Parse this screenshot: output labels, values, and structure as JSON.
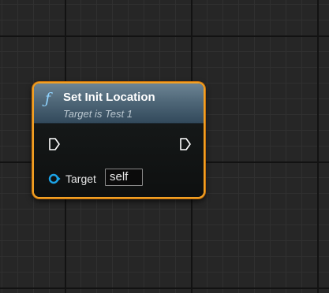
{
  "node": {
    "icon": "function-icon",
    "icon_glyph": "ƒ",
    "title": "Set Init Location",
    "subtitle": "Target is Test 1",
    "pins": {
      "exec_in": "exec-input-pin",
      "exec_out": "exec-output-pin",
      "target": {
        "label": "Target",
        "value": "self"
      }
    },
    "colors": {
      "selection_border": "#f2a024",
      "header_top": "#6d8494",
      "header_bottom": "#31485a",
      "object_pin": "#1ca4e8",
      "exec_pin": "#ffffff",
      "graph_background": "#262626"
    }
  }
}
